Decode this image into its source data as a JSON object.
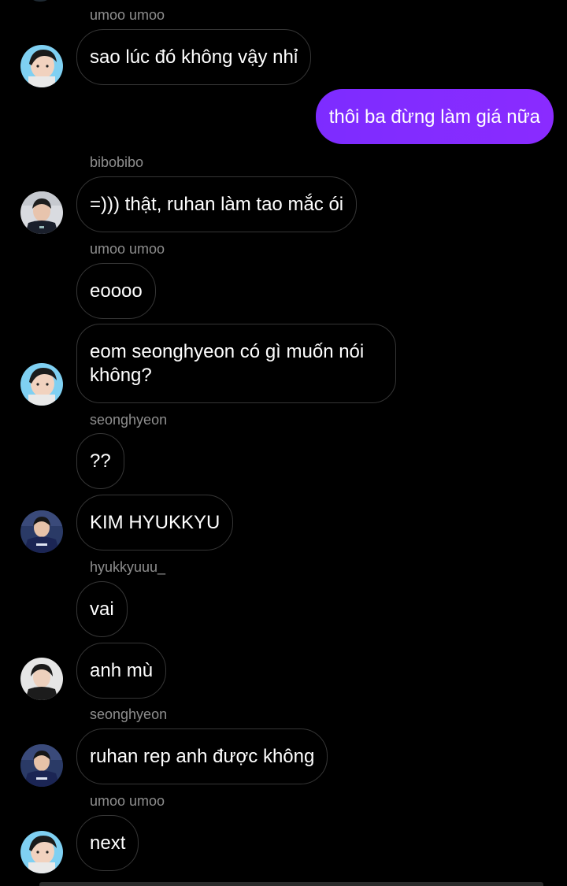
{
  "messages": [
    {
      "sender": "umoo umoo",
      "text": "sao lúc đó không vậy nhỉ"
    },
    {
      "sender": "",
      "text": "thôi ba đừng làm giá nữa"
    },
    {
      "sender": "bibobibo",
      "text": "=))) thật, ruhan làm tao mắc ói"
    },
    {
      "sender": "umoo umoo",
      "text": "eoooo"
    },
    {
      "sender": "",
      "text": "eom seonghyeon có gì muốn nói không?"
    },
    {
      "sender": "seonghyeon",
      "text": "??"
    },
    {
      "sender": "",
      "text": "KIM HYUKKYU"
    },
    {
      "sender": "hyukkyuuu_",
      "text": "vai"
    },
    {
      "sender": "",
      "text": "anh mù"
    },
    {
      "sender": "seonghyeon",
      "text": "ruhan rep anh được không"
    },
    {
      "sender": "umoo umoo",
      "text": "next"
    }
  ],
  "colors": {
    "background": "#000000",
    "sent_bubble": "#8a2bff",
    "received_border": "#363636",
    "sender_name": "#8e8e8e"
  }
}
